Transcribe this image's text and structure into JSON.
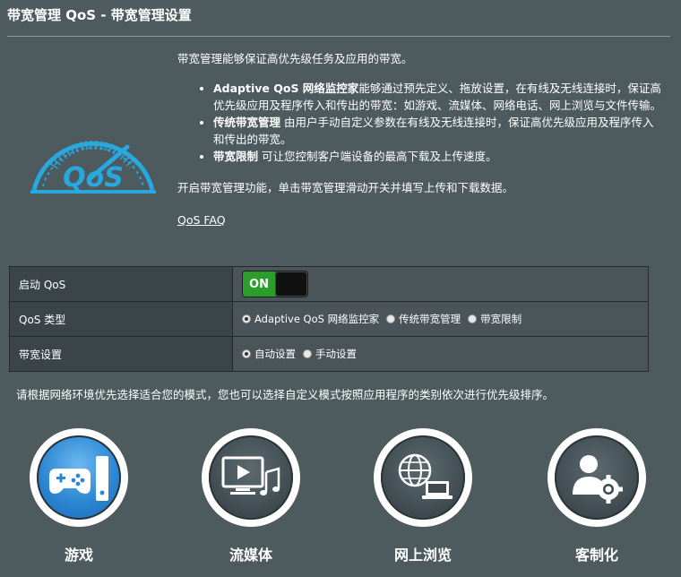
{
  "header": {
    "title": "带宽管理 QoS - 带宽管理设置"
  },
  "intro": {
    "text": "带宽管理能够保证高优先级任务及应用的带宽。",
    "bullets": [
      {
        "strong": "Adaptive QoS 网络监控家",
        "text": "能够通过预先定义、拖放设置，在有线及无线连接时，保证高优先级应用及程序传入和传出的带宽：如游戏、流媒体、网络电话、网上浏览与文件传输。"
      },
      {
        "strong": "传统带宽管理",
        "text": " 由用户手动自定义参数在有线及无线连接时，保证高优先级应用及程序传入和传出的带宽。"
      },
      {
        "strong": "带宽限制",
        "text": " 可让您控制客户端设备的最高下载及上传速度。"
      }
    ],
    "enable_text": "开启带宽管理功能，单击带宽管理滑动开关并填写上传和下载数据。",
    "faq_link": "QoS FAQ",
    "logo_text": "QoS"
  },
  "settings": {
    "enable": {
      "label": "启动 QoS",
      "toggle_on": "ON"
    },
    "type": {
      "label": "QoS 类型",
      "options": [
        "Adaptive QoS 网络监控家",
        "传统带宽管理",
        "带宽限制"
      ],
      "selected": "Adaptive QoS 网络监控家"
    },
    "bandwidth": {
      "label": "带宽设置",
      "options": [
        "自动设置",
        "手动设置"
      ],
      "selected": "自动设置"
    }
  },
  "modes": {
    "hint": "请根据网络环境优先选择适合您的模式，您也可以选择自定义模式按照应用程序的类别依次进行优先级排序。",
    "items": [
      {
        "label": "游戏",
        "icon": "gamepad-icon"
      },
      {
        "label": "流媒体",
        "icon": "media-icon"
      },
      {
        "label": "网上浏览",
        "icon": "web-browsing-icon"
      },
      {
        "label": "客制化",
        "icon": "customize-icon"
      }
    ],
    "selected": "游戏"
  },
  "colors": {
    "background": "#4d5a5e",
    "accent": "#2c86d2",
    "toggle_on": "#2a9d2a",
    "logo": "#29a8e0"
  }
}
